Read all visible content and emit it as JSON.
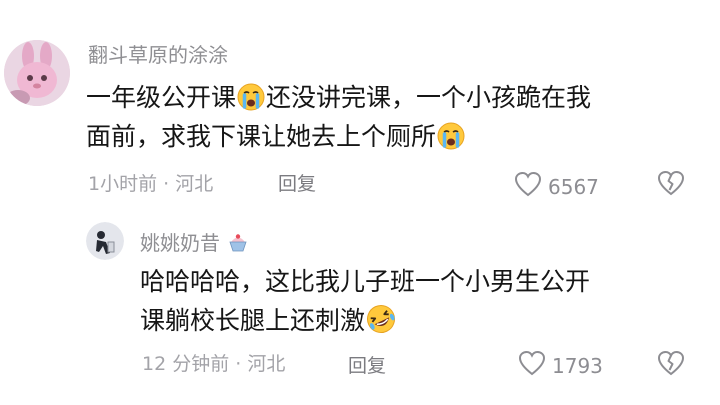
{
  "comments": [
    {
      "username": "翻斗草原的涂涂",
      "text_line1_a": "一年级公开课",
      "text_line1_b": "还没讲完课，一个小孩跪在我",
      "text_line2": "面前，求我下课让她去上个厕所",
      "emoji_1": "crying-face-icon",
      "emoji_2": "crying-face-icon",
      "meta": "1小时前 · 河北",
      "reply_label": "回复",
      "like_count": "6567"
    },
    {
      "username": "姚姚奶昔",
      "text_line1": "哈哈哈哈，这比我儿子班一个小男生公开",
      "text_line2": "课躺校长腿上还刺激",
      "emoji": "rolling-laughing-face-icon",
      "meta": "12 分钟前 · 河北",
      "reply_label": "回复",
      "like_count": "1793"
    }
  ],
  "colors": {
    "text": "#161616",
    "secondary": "#8f8f93",
    "emoji": "#ffc93c"
  }
}
